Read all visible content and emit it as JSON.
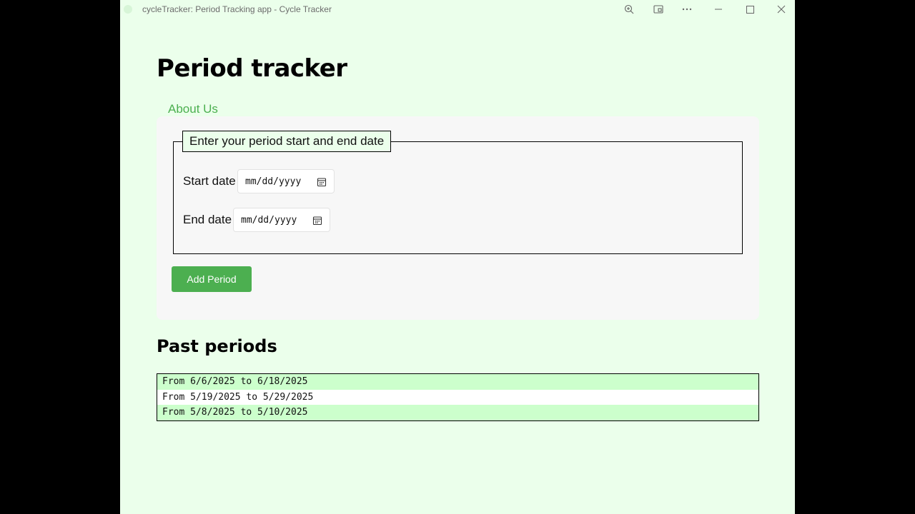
{
  "window": {
    "title": "cycleTracker: Period Tracking app - Cycle Tracker",
    "controls": {
      "zoom_icon": "zoom-in-icon",
      "app_icon": "open-in-app-icon",
      "more_icon": "more-icon",
      "minimize_icon": "minimize-icon",
      "maximize_icon": "maximize-icon",
      "close_icon": "close-icon"
    }
  },
  "page": {
    "title": "Period tracker",
    "about_link": "About Us"
  },
  "form": {
    "legend": "Enter your period start and end date",
    "start": {
      "label": "Start date",
      "placeholder": "mm/dd/yyyy"
    },
    "end": {
      "label": "End date",
      "placeholder": "mm/dd/yyyy"
    },
    "submit_label": "Add Period"
  },
  "past": {
    "title": "Past periods",
    "items": [
      "From 6/6/2025 to 6/18/2025",
      "From 5/19/2025 to 5/29/2025",
      "From 5/8/2025 to 5/10/2025"
    ]
  },
  "colors": {
    "page_bg": "#ebffeb",
    "accent": "#4caf50",
    "row_highlight": "#ccffcc"
  }
}
